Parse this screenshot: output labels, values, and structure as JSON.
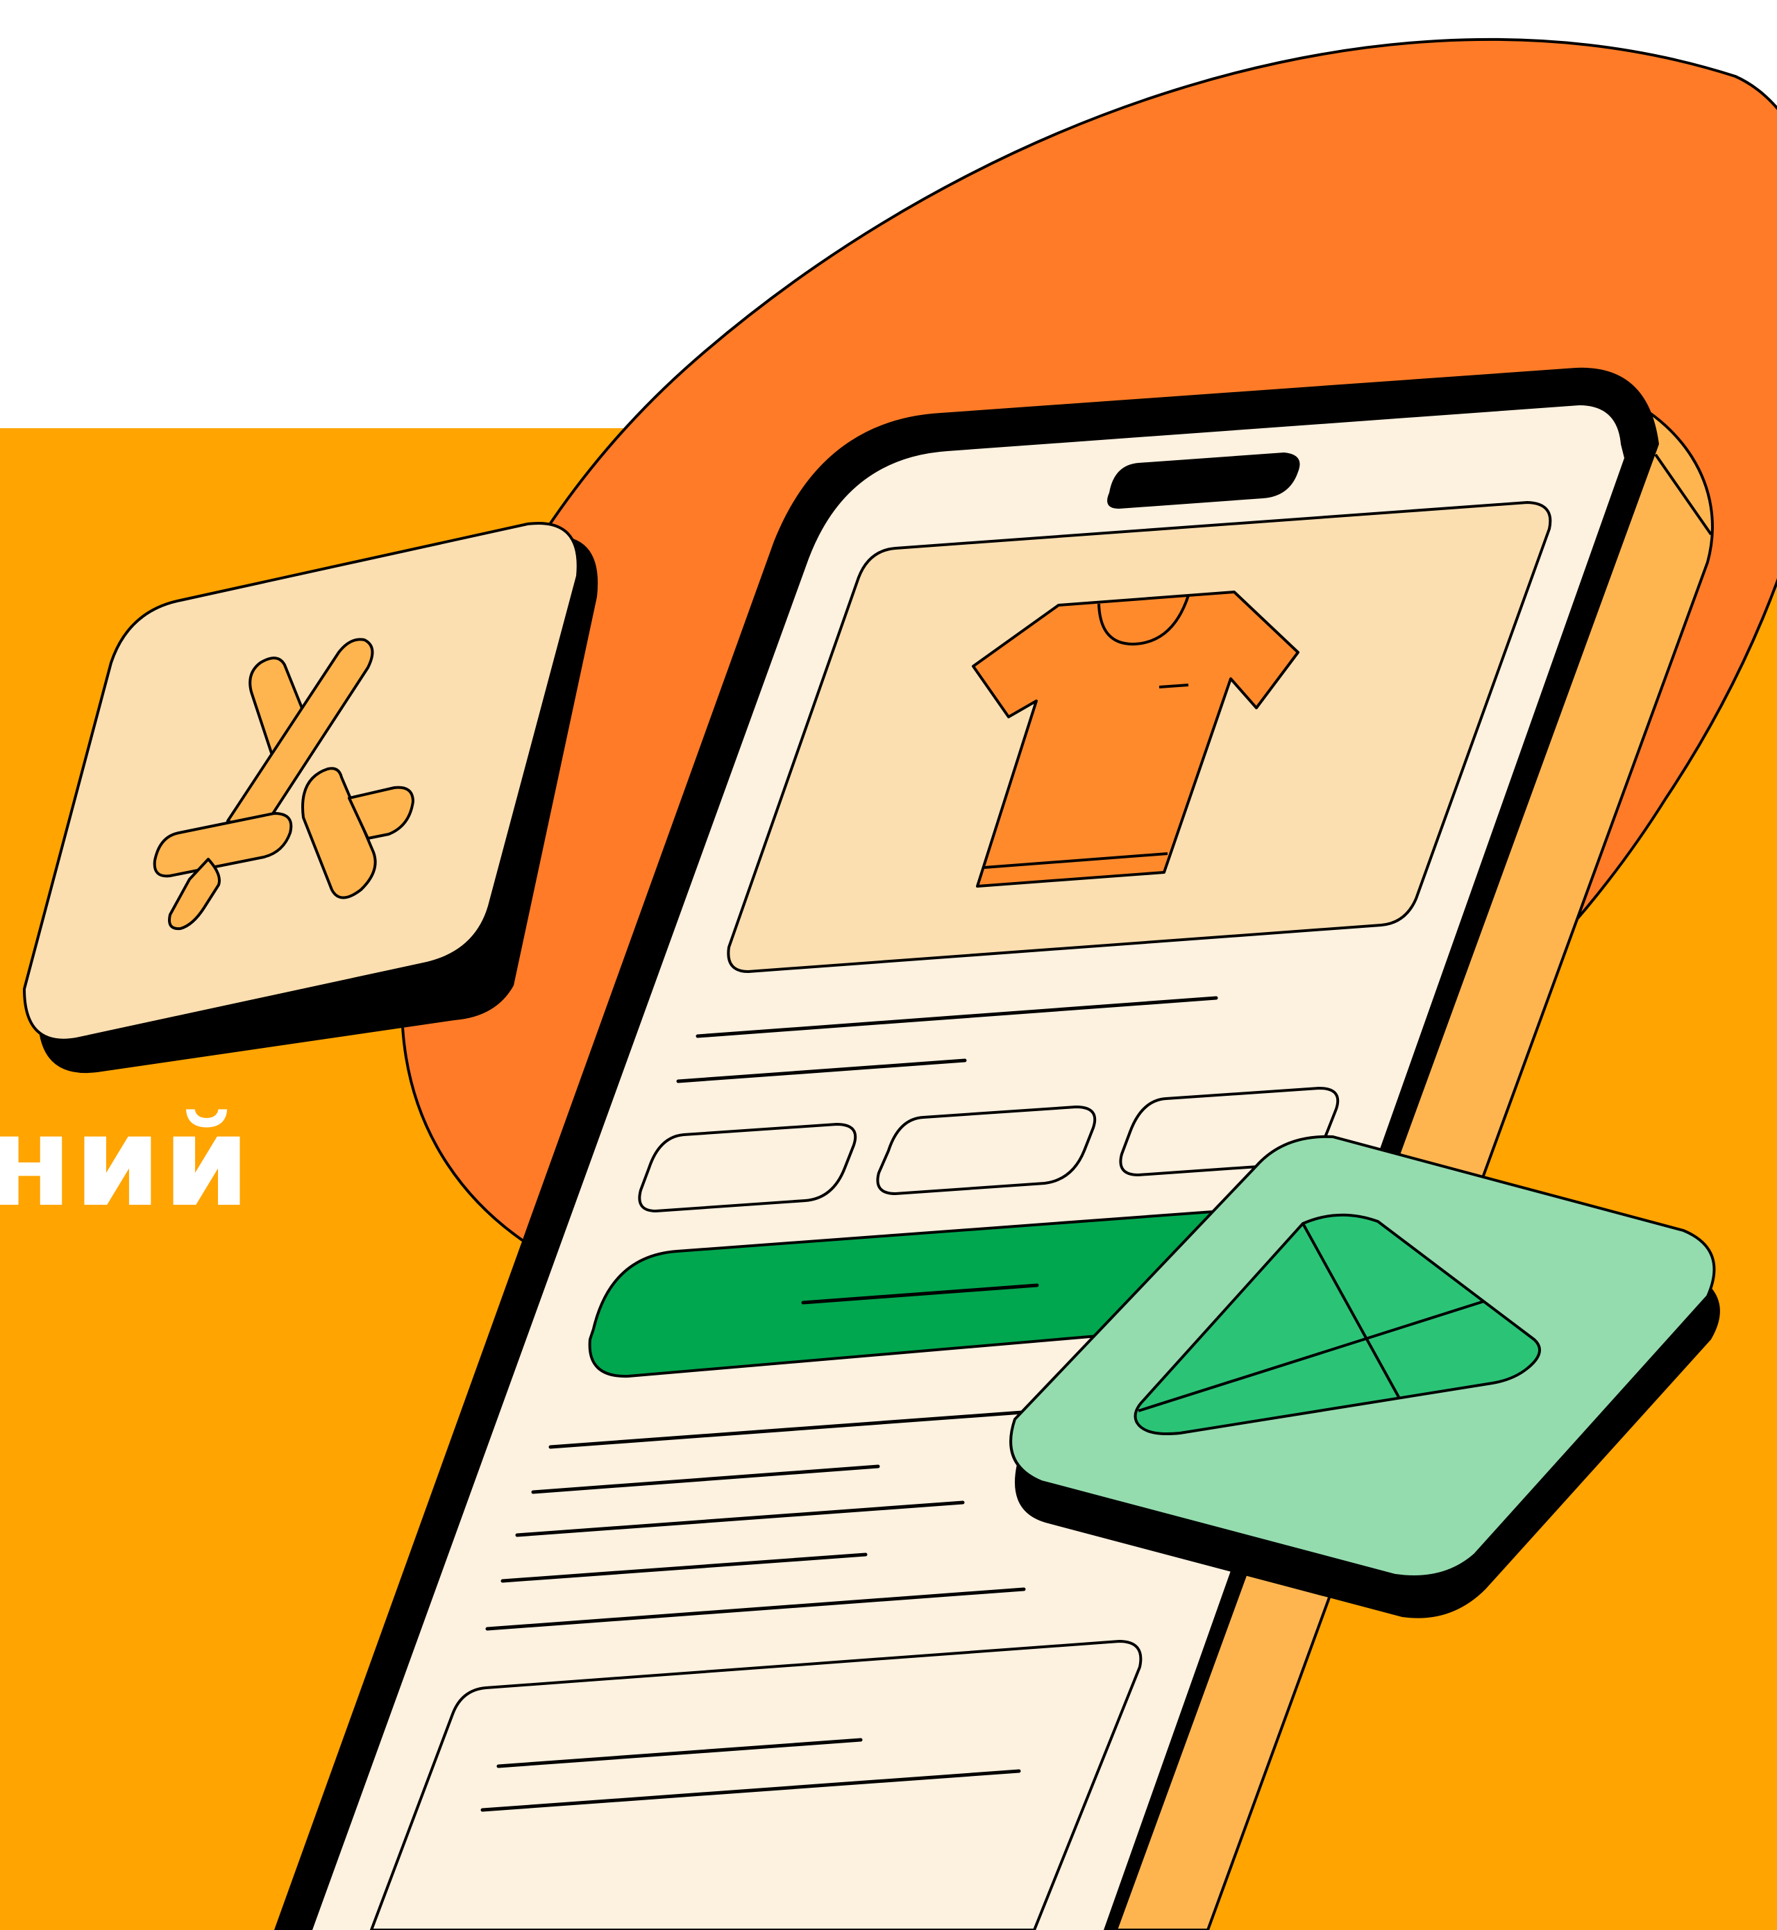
{
  "caption": {
    "text": "ний"
  },
  "colors": {
    "page_background": "#ffffff",
    "banner": "#ffa400",
    "blob": "#ff7b27",
    "phone_side": "#ffb54f",
    "screen": "#fdf1df",
    "card": "#fcdfb1",
    "shirt": "#ff8a2c",
    "buy_button": "#00a74f",
    "app_tile_green": "#94dcae",
    "plane_green": "#2bc477",
    "tool_orange": "#ffb54f",
    "outline": "#000000"
  },
  "icons": {
    "left_tile": "tools-icon",
    "product": "tshirt-icon",
    "right_tile": "paper-plane-icon"
  }
}
